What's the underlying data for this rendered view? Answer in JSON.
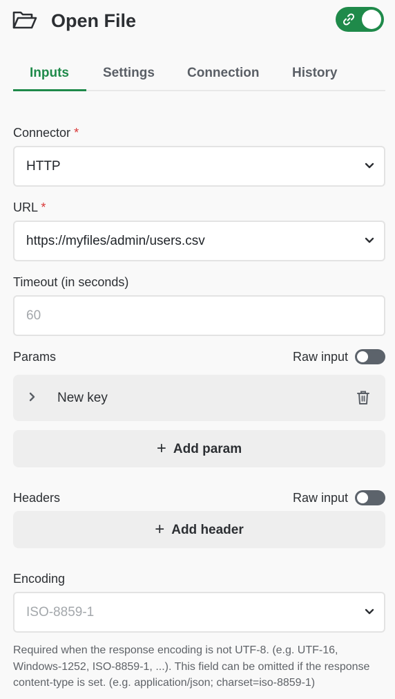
{
  "header": {
    "title": "Open File",
    "folder_icon": "folder-open-icon",
    "link_icon": "link-icon"
  },
  "tabs": [
    {
      "label": "Inputs",
      "active": true
    },
    {
      "label": "Settings",
      "active": false
    },
    {
      "label": "Connection",
      "active": false
    },
    {
      "label": "History",
      "active": false
    }
  ],
  "connector": {
    "label": "Connector",
    "required": "*",
    "value": "HTTP"
  },
  "url": {
    "label": "URL",
    "required": "*",
    "value": "https://myfiles/admin/users.csv"
  },
  "timeout": {
    "label": "Timeout (in seconds)",
    "placeholder": "60"
  },
  "params": {
    "label": "Params",
    "raw_label": "Raw input",
    "item_label": "New key",
    "add_label": "Add param"
  },
  "headers": {
    "label": "Headers",
    "raw_label": "Raw input",
    "add_label": "Add header"
  },
  "encoding": {
    "label": "Encoding",
    "placeholder": "ISO-8859-1",
    "help": "Required when the response encoding is not UTF-8. (e.g. UTF-16, Windows-1252, ISO-8859-1, ...). This field can be omitted if the response content-type is set. (e.g. application/json; charset=iso-8859-1)"
  },
  "colors": {
    "accent": "#1f8a4a",
    "required": "#d93838",
    "toggle_off": "#5c636b"
  }
}
